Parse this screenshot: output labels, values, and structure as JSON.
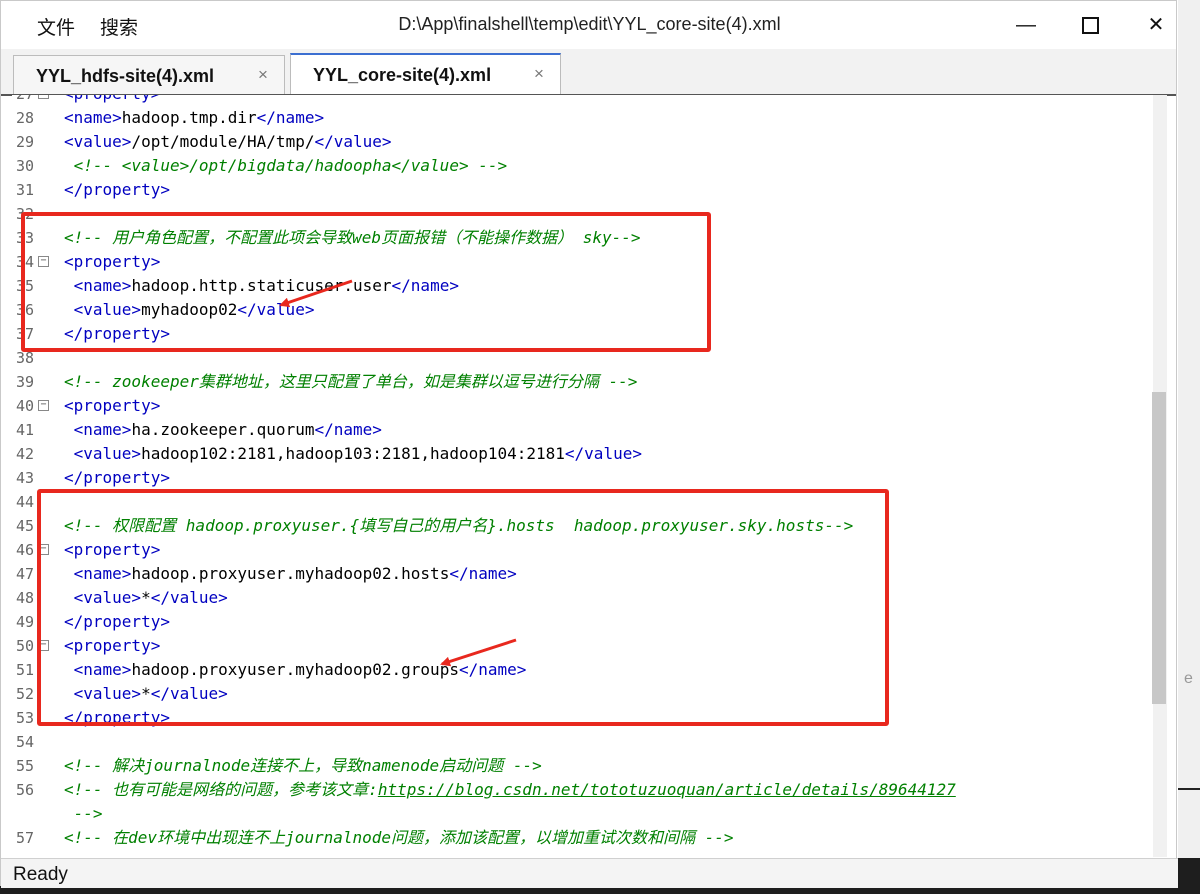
{
  "menu": {
    "file": "文件",
    "search": "搜索"
  },
  "window": {
    "title": "D:\\App\\finalshell\\temp\\edit\\YYL_core-site(4).xml"
  },
  "tabs": [
    {
      "label": "YYL_hdfs-site(4).xml",
      "close": "×"
    },
    {
      "label": "YYL_core-site(4).xml",
      "close": "×"
    }
  ],
  "lines": [
    {
      "n": "27",
      "a": "<",
      "b": "property",
      "c": ">",
      "partial": true
    },
    {
      "n": "28",
      "open": "<name>",
      "text": "hadoop.tmp.dir",
      "close": "</name>"
    },
    {
      "n": "29",
      "open": "<value>",
      "text": "/opt/module/HA/tmp/",
      "close": "</value>"
    },
    {
      "n": "30",
      "comment": " <!-- <value>/opt/bigdata/hadoopha</value> -->"
    },
    {
      "n": "31",
      "close": "</property>"
    },
    {
      "n": "32"
    },
    {
      "n": "33",
      "comment": "<!-- 用户角色配置，不配置此项会导致web页面报错（不能操作数据） sky-->"
    },
    {
      "n": "34",
      "open": "<property>"
    },
    {
      "n": "35",
      "open": " <name>",
      "text": "hadoop.http.staticuser.user",
      "close": "</name>"
    },
    {
      "n": "36",
      "open": " <value>",
      "text": "myhadoop02",
      "close": "</value>"
    },
    {
      "n": "37",
      "close": "</property>"
    },
    {
      "n": "38"
    },
    {
      "n": "39",
      "comment": "<!-- zookeeper集群地址，这里只配置了单台，如是集群以逗号进行分隔 -->"
    },
    {
      "n": "40",
      "open": "<property>"
    },
    {
      "n": "41",
      "open": " <name>",
      "text": "ha.zookeeper.quorum",
      "close": "</name>"
    },
    {
      "n": "42",
      "open": " <value>",
      "text": "hadoop102:2181,hadoop103:2181,hadoop104:2181",
      "close": "</value>"
    },
    {
      "n": "43",
      "close": "</property>"
    },
    {
      "n": "44"
    },
    {
      "n": "45",
      "comment": "<!-- 权限配置 hadoop.proxyuser.{填写自己的用户名}.hosts  hadoop.proxyuser.sky.hosts-->"
    },
    {
      "n": "46",
      "open": "<property>"
    },
    {
      "n": "47",
      "open": " <name>",
      "text": "hadoop.proxyuser.myhadoop02.hosts",
      "close": "</name>"
    },
    {
      "n": "48",
      "open": " <value>",
      "text": "*",
      "close": "</value>"
    },
    {
      "n": "49",
      "close": "</property>"
    },
    {
      "n": "50",
      "open": "<property>"
    },
    {
      "n": "51",
      "open": " <name>",
      "text": "hadoop.proxyuser.myhadoop02.groups",
      "close": "</name>"
    },
    {
      "n": "52",
      "open": " <value>",
      "text": "*",
      "close": "</value>"
    },
    {
      "n": "53",
      "close": "</property>"
    },
    {
      "n": "54"
    },
    {
      "n": "55",
      "comment": "<!-- 解决journalnode连接不上，导致namenode启动问题 -->"
    },
    {
      "n": "56",
      "commentPre": "<!-- 也有可能是网络的问题，参考该文章:",
      "link": "https://blog.csdn.net/tototuzuoquan/article/details/89644127"
    },
    {
      "n": "",
      "comment": " -->"
    },
    {
      "n": "57",
      "comment": "<!-- 在dev环境中出现连不上journalnode问题，添加该配置，以增加重试次数和间隔 -->"
    }
  ],
  "status": {
    "text": "Ready"
  },
  "colors": {
    "tag": "#0000c0",
    "comment": "#008000",
    "annotation": "#e8281e"
  }
}
